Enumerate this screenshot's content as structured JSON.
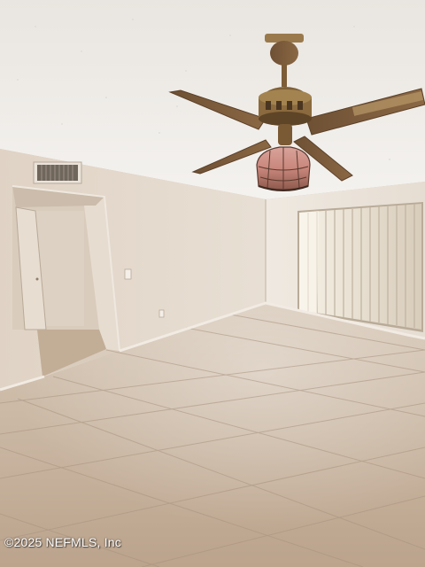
{
  "photo": {
    "subject": "empty-room-with-ceiling-fan",
    "watermark": "©2025 NEFMLS, Inc",
    "colors": {
      "ceiling": "#f0ede9",
      "wall_left": "#e3d8cc",
      "wall_right": "#ece6dd",
      "floor": "#c4b09b",
      "grout": "#a89684",
      "fan_wood": "#7a5a3c",
      "fan_brass": "#8a6a3e",
      "curtain": "#ddd3c3"
    }
  }
}
